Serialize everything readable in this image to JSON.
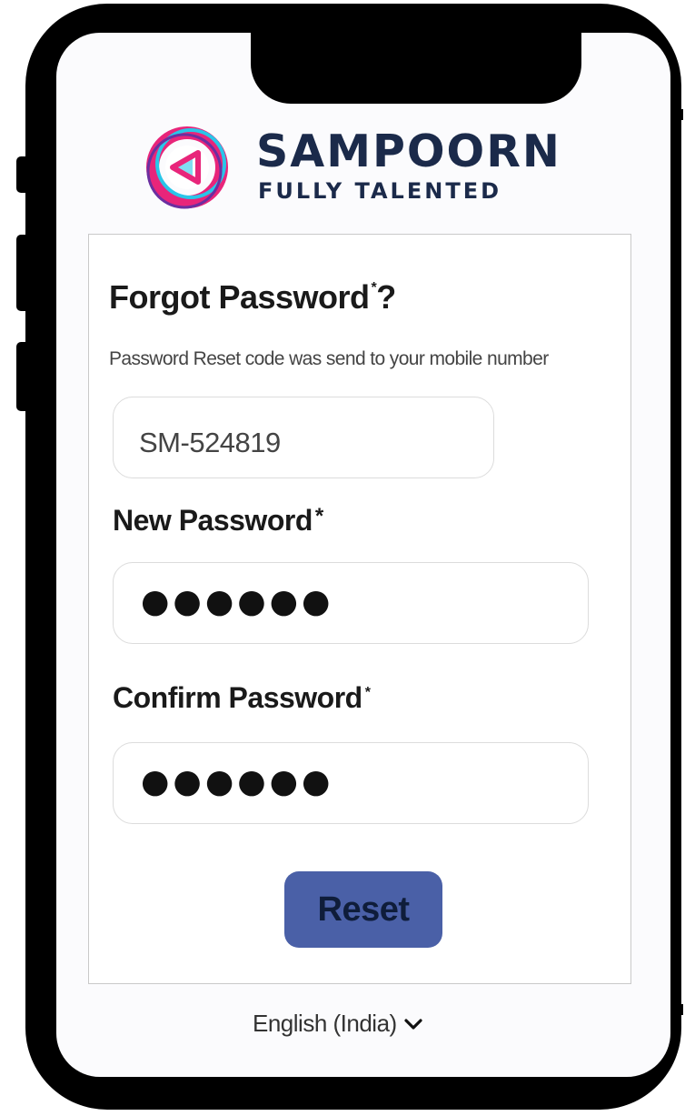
{
  "logo": {
    "brand_name": "SAMPOORN",
    "tagline": "FULLY TALENTED"
  },
  "form": {
    "title": "Forgot Password",
    "title_mark": "*",
    "title_suffix": "?",
    "subtitle": "Password Reset code was send to your mobile number",
    "reset_code_value": "SM-524819",
    "new_password": {
      "label": "New Password",
      "required_mark": "*",
      "masked_value": "●●●●●●"
    },
    "confirm_password": {
      "label": "Confirm Password",
      "required_mark": "*",
      "masked_value": "●●●●●●"
    },
    "reset_button_label": "Reset"
  },
  "footer": {
    "language": "English (India)"
  },
  "colors": {
    "button": "#4a60a7",
    "brand_text": "#1b2a4a",
    "logo_magenta": "#e8257a",
    "logo_cyan": "#29c6e8",
    "logo_purple": "#6b2fa0"
  }
}
